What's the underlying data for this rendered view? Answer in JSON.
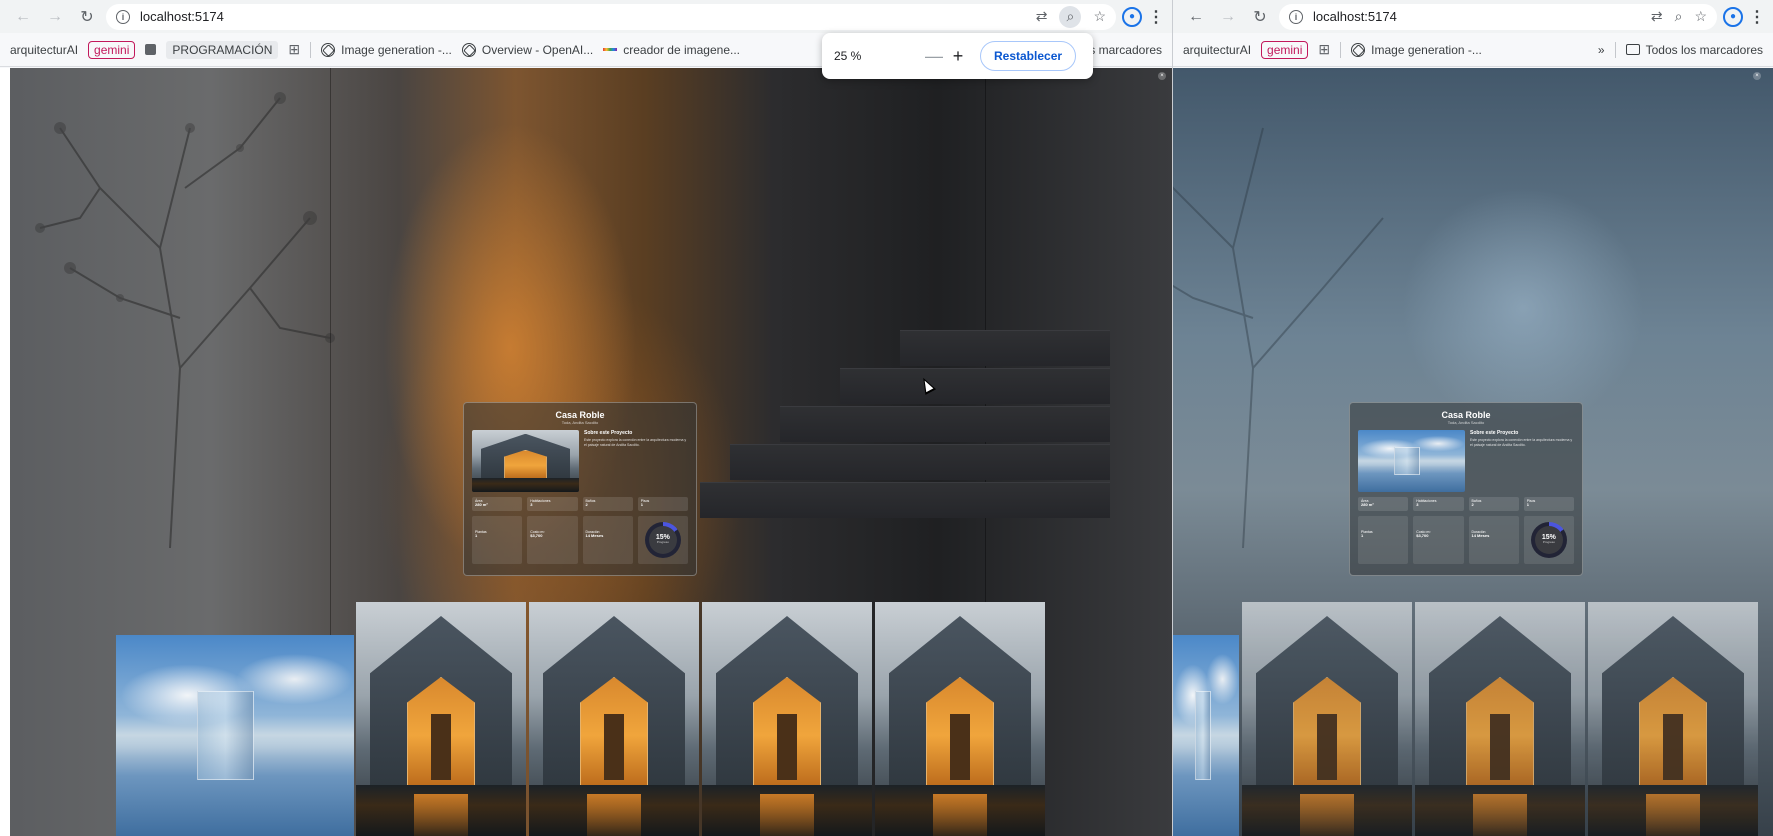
{
  "left": {
    "url": "localhost:5174",
    "bookmarks": [
      "arquitecturAI",
      "gemini",
      "PROGRAMACIÓN",
      "Image generation -...",
      "Overview - OpenAI...",
      "creador de imagene...",
      "os marcadores"
    ],
    "zoom": {
      "level": "25 %",
      "minus": "—",
      "plus": "+",
      "reset": "Restablecer"
    },
    "card": {
      "title": "Casa Roble",
      "subtitle": "Toda, Andita Sacdito",
      "about_title": "Sobre este Proyecto",
      "about_text": "Este proyecto explora la conexión entre la arquitectura moderna y el paisaje natural de Andita Sacdito.",
      "stats": [
        {
          "label": "Área",
          "value": "280 m²"
        },
        {
          "label": "Habitaciones",
          "value": "3"
        },
        {
          "label": "Baños",
          "value": "2"
        },
        {
          "label": "Pisos",
          "value": "1"
        }
      ],
      "metrics": [
        {
          "label": "Plantas",
          "value": "1"
        },
        {
          "label": "Costo m²",
          "value": "$3,700"
        },
        {
          "label": "Duración",
          "value": "14 Meses"
        }
      ],
      "progress": {
        "value": 15,
        "label": "15%",
        "caption": "Progreso"
      }
    }
  },
  "right": {
    "url": "localhost:5174",
    "bookmarks": [
      "arquitecturAI",
      "gemini",
      "Image generation -...",
      "»",
      "Todos los marcadores"
    ],
    "card": {
      "title": "Casa Roble",
      "subtitle": "Toda, Andita Sacdito",
      "about_title": "Sobre este Proyecto",
      "about_text": "Este proyecto explora la conexión entre la arquitectura moderna y el paisaje natural de Andita Sacdito.",
      "stats": [
        {
          "label": "Área",
          "value": "280 m²"
        },
        {
          "label": "Habitaciones",
          "value": "3"
        },
        {
          "label": "Baños",
          "value": "2"
        },
        {
          "label": "Pisos",
          "value": "1"
        }
      ],
      "metrics": [
        {
          "label": "Plantas",
          "value": "1"
        },
        {
          "label": "Costo m²",
          "value": "$3,700"
        },
        {
          "label": "Duración",
          "value": "14 Meses"
        }
      ],
      "progress": {
        "value": 15,
        "label": "15%",
        "caption": "Progreso"
      }
    }
  },
  "icons": [
    "back-icon",
    "forward-icon",
    "reload-icon",
    "info-icon",
    "translate-icon",
    "zoom-icon",
    "star-icon",
    "profile-icon",
    "menu-icon",
    "grid-icon",
    "openai-icon",
    "folder-icon",
    "close-icon"
  ],
  "colors": {
    "accent": "#0b57d0",
    "gemini": "#c2185b",
    "gauge": "#4b55e0"
  }
}
